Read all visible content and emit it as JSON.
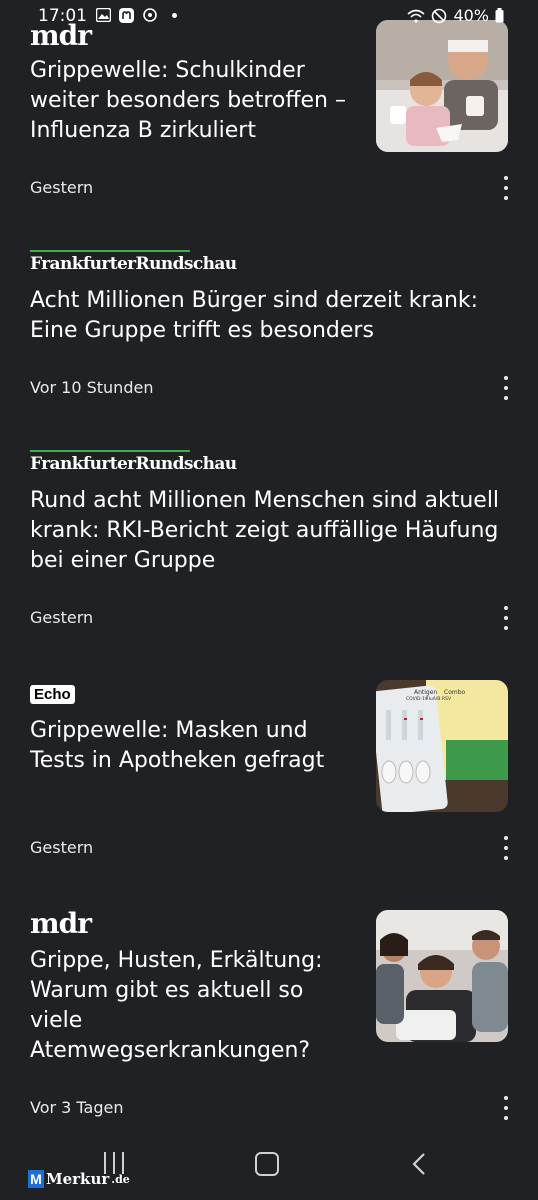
{
  "status_bar": {
    "time": "17:01",
    "battery": "40%"
  },
  "articles": [
    {
      "source": "mdr",
      "title": "Grippewelle: Schulkinder weiter besonders betroffen – Influenza B zirkuliert",
      "time": "Gestern",
      "thumbnail": "family-sick-on-couch"
    },
    {
      "source": "FrankfurterRundschau",
      "title": "Acht Millionen Bürger sind derzeit krank: Eine Gruppe trifft es besonders",
      "time": "Vor 10 Stunden"
    },
    {
      "source": "FrankfurterRundschau",
      "title": "Rund acht Millionen Menschen sind aktuell krank: RKI-Bericht zeigt auffällige Häufung bei einer Gruppe",
      "time": "Gestern"
    },
    {
      "source": "Echo",
      "title": "Grippewelle: Masken und Tests in Apotheken gefragt",
      "time": "Gestern",
      "thumbnail": "antigen-test-kit",
      "thumb_labels": [
        "Antigen",
        "Combo",
        "COVID-19",
        "FluA/B",
        "RSV"
      ]
    },
    {
      "source": "mdr",
      "title": "Grippe, Husten, Erkältung: Warum gibt es aktuell so viele Atemwegserkrankungen?",
      "time": "Vor 3 Tagen",
      "thumbnail": "sick-child-with-parents"
    }
  ],
  "watermark": {
    "logo_letter": "M",
    "name": "Merkur",
    "tld": ".de"
  },
  "colors": {
    "background": "#202124",
    "fr_accent": "#3fae49"
  }
}
